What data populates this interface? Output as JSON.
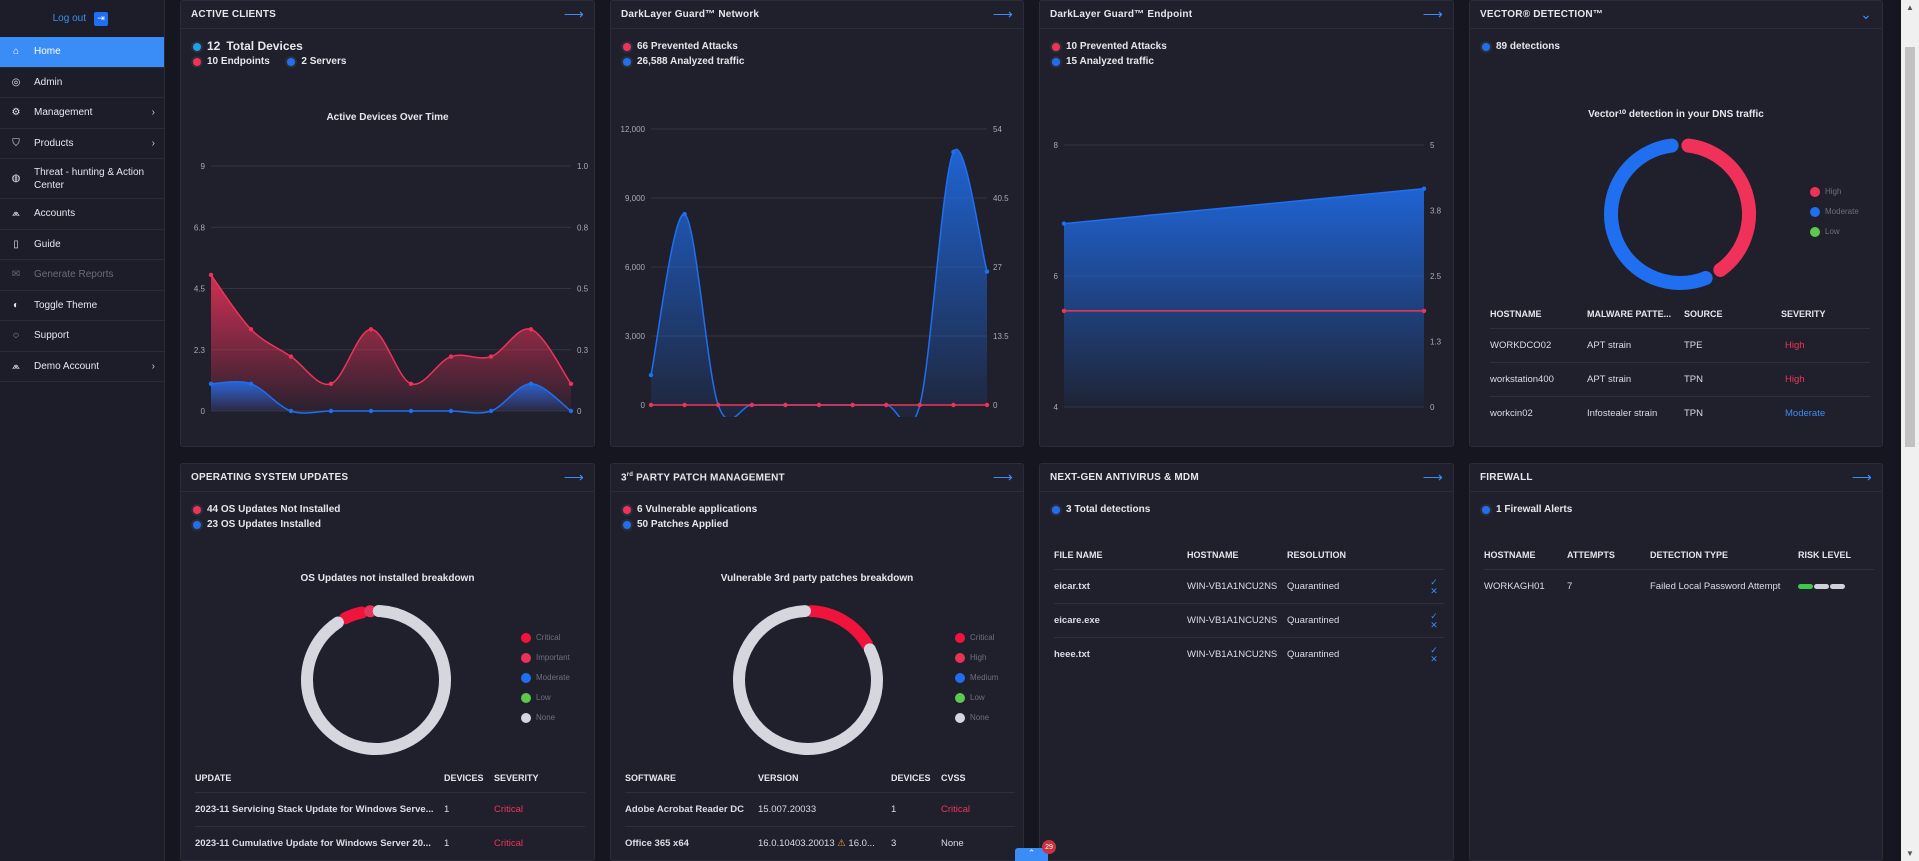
{
  "sidebar": {
    "logout_label": "Log out",
    "items": [
      {
        "label": "Home",
        "icon": "home-icon",
        "active": true
      },
      {
        "label": "Admin",
        "icon": "admin-icon"
      },
      {
        "label": "Management",
        "icon": "management-icon",
        "chevron": true
      },
      {
        "label": "Products",
        "icon": "products-icon",
        "chevron": true
      },
      {
        "label": "Threat - hunting & Action Center",
        "icon": "globe-icon"
      },
      {
        "label": "Accounts",
        "icon": "accounts-icon"
      },
      {
        "label": "Guide",
        "icon": "guide-icon"
      },
      {
        "label": "Generate Reports",
        "icon": "reports-icon",
        "disabled": true
      },
      {
        "label": "Toggle Theme",
        "icon": "theme-icon"
      },
      {
        "label": "Support",
        "icon": "support-icon"
      },
      {
        "label": "Demo Account",
        "icon": "account-icon",
        "chevron": true
      }
    ]
  },
  "colors": {
    "accent": "#3a8cf6",
    "red": "#f0325a",
    "blue": "#1f6ff0",
    "panel": "#1f202c",
    "bg": "#15161f"
  },
  "active_clients": {
    "title": "ACTIVE CLIENTS",
    "total_count": "12",
    "total_label": "Total Devices",
    "endpoints": "10 Endpoints",
    "servers": "2 Servers",
    "chart_title": "Active Devices Over Time"
  },
  "network": {
    "title": "DarkLayer Guard™ Network",
    "attacks": "66 Prevented Attacks",
    "traffic": "26,588 Analyzed traffic"
  },
  "endpoint": {
    "title": "DarkLayer Guard™ Endpoint",
    "attacks": "10 Prevented Attacks",
    "traffic": "15 Analyzed traffic"
  },
  "vector": {
    "title": "VECTOR® DETECTION™",
    "detections": "89 detections",
    "chart_title": "Vector¹⁰ detection in your DNS traffic",
    "legend": [
      "High",
      "Moderate",
      "Low"
    ],
    "columns": [
      "HOSTNAME",
      "MALWARE PATTE...",
      "SOURCE",
      "SEVERITY"
    ],
    "rows": [
      {
        "host": "WORKDCO02",
        "pattern": "APT strain",
        "source": "TPE",
        "severity": "High"
      },
      {
        "host": "workstation400",
        "pattern": "APT strain",
        "source": "TPN",
        "severity": "High"
      },
      {
        "host": "workcin02",
        "pattern": "Infostealer strain",
        "source": "TPN",
        "severity": "Moderate"
      }
    ]
  },
  "os_updates": {
    "title": "OPERATING SYSTEM UPDATES",
    "not_installed": "44 OS Updates Not Installed",
    "installed": "23 OS Updates Installed",
    "chart_title": "OS Updates not installed breakdown",
    "legend": [
      "Critical",
      "Important",
      "Moderate",
      "Low",
      "None"
    ],
    "columns": [
      "UPDATE",
      "DEVICES",
      "SEVERITY"
    ],
    "rows": [
      {
        "update": "2023-11 Servicing Stack Update for Windows Serve...",
        "devices": "1",
        "severity": "Critical"
      },
      {
        "update": "2023-11 Cumulative Update for Windows Server 20...",
        "devices": "1",
        "severity": "Critical"
      }
    ]
  },
  "patch": {
    "title_prefix": "3",
    "title_sup": "rd",
    "title_rest": " PARTY PATCH MANAGEMENT",
    "vulnerable": "6 Vulnerable applications",
    "applied": "50 Patches Applied",
    "chart_title": "Vulnerable 3rd party patches breakdown",
    "legend": [
      "Critical",
      "High",
      "Medium",
      "Low",
      "None"
    ],
    "columns": [
      "SOFTWARE",
      "VERSION",
      "DEVICES",
      "CVSS"
    ],
    "rows": [
      {
        "software": "Adobe Acrobat Reader DC",
        "version": "15.007.20033",
        "version2": "",
        "devices": "1",
        "cvss": "Critical"
      },
      {
        "software": "Office 365 x64",
        "version": "16.0.10403.20013",
        "version2": "16.0...",
        "devices": "3",
        "cvss": "None"
      }
    ]
  },
  "antivirus": {
    "title": "NEXT-GEN ANTIVIRUS & MDM",
    "detections": "3 Total detections",
    "columns": [
      "FILE NAME",
      "HOSTNAME",
      "RESOLUTION"
    ],
    "rows": [
      {
        "file": "eicar.txt",
        "host": "WIN-VB1A1NCU2NS",
        "resolution": "Quarantined"
      },
      {
        "file": "eicare.exe",
        "host": "WIN-VB1A1NCU2NS",
        "resolution": "Quarantined"
      },
      {
        "file": "heee.txt",
        "host": "WIN-VB1A1NCU2NS",
        "resolution": "Quarantined"
      }
    ]
  },
  "firewall": {
    "title": "FIREWALL",
    "alerts": "1 Firewall Alerts",
    "columns": [
      "HOSTNAME",
      "ATTEMPTS",
      "DETECTION TYPE",
      "RISK LEVEL"
    ],
    "rows": [
      {
        "host": "WORKAGH01",
        "attempts": "7",
        "type": "Failed Local Password Attempt",
        "risk_level": 1
      }
    ]
  },
  "notification_count": "29",
  "chart_data": [
    {
      "type": "area",
      "title": "Active Devices Over Time",
      "x": [
        0,
        1,
        2,
        3,
        4,
        5,
        6,
        7,
        8,
        9
      ],
      "ylim": [
        0,
        9
      ],
      "y2lim": [
        0,
        1.0
      ],
      "yticks": [
        "0",
        "2.3",
        "4.5",
        "6.8",
        "9"
      ],
      "y2ticks": [
        "0",
        "0.3",
        "0.5",
        "0.8",
        "1.0"
      ],
      "series": [
        {
          "name": "Endpoints",
          "color": "#f0325a",
          "values": [
            5,
            3,
            2,
            1,
            3,
            1,
            2,
            2,
            3,
            1
          ]
        },
        {
          "name": "Servers",
          "color": "#1f6ff0",
          "values": [
            1,
            1,
            0,
            0,
            0,
            0,
            0,
            0,
            1,
            0
          ]
        }
      ]
    },
    {
      "type": "area",
      "title": "",
      "x": [
        0,
        1,
        2,
        3,
        4,
        5,
        6,
        7,
        8,
        9,
        10
      ],
      "ylim": [
        0,
        12000
      ],
      "y2lim": [
        0,
        54
      ],
      "yticks": [
        "0",
        "3,000",
        "6,000",
        "9,000",
        "12,000"
      ],
      "y2ticks": [
        "0",
        "13.5",
        "27",
        "40.5",
        "54"
      ],
      "series": [
        {
          "name": "Analyzed traffic",
          "color": "#1f6ff0",
          "values": [
            1300,
            8300,
            0,
            0,
            0,
            0,
            0,
            0,
            0,
            11000,
            5800
          ]
        },
        {
          "name": "Prevented Attacks",
          "color": "#f0325a",
          "values": [
            0,
            0,
            0,
            0,
            0,
            0,
            0,
            0,
            0.1,
            0.2,
            0
          ]
        }
      ]
    },
    {
      "type": "area",
      "title": "",
      "x": [
        0,
        1
      ],
      "ylim": [
        3,
        9
      ],
      "y2lim": [
        0,
        5
      ],
      "yticks": [
        "4",
        "6",
        "8"
      ],
      "y2ticks": [
        "0",
        "1.3",
        "2.5",
        "3.8",
        "5"
      ],
      "series": [
        {
          "name": "Analyzed traffic",
          "color": "#1f6ff0",
          "values": [
            7.2,
            8
          ]
        },
        {
          "name": "Prevented Attacks",
          "color": "#f0325a",
          "values": [
            5.2,
            5.2
          ]
        }
      ]
    },
    {
      "type": "pie",
      "title": "Vector¹⁰ detection in your DNS traffic",
      "categories": [
        "High",
        "Moderate",
        "Low"
      ],
      "values": [
        42,
        58,
        0
      ],
      "colors": [
        "#f0325a",
        "#1f6ff0",
        "#5ec84a"
      ]
    },
    {
      "type": "pie",
      "title": "OS Updates not installed breakdown",
      "categories": [
        "Critical",
        "Important",
        "Moderate",
        "Low",
        "None"
      ],
      "values": [
        6,
        2,
        0,
        0,
        92
      ],
      "colors": [
        "#f0143c",
        "#e8325a",
        "#1f6ff0",
        "#5ec84a",
        "#d6d6de"
      ]
    },
    {
      "type": "pie",
      "title": "Vulnerable 3rd party patches breakdown",
      "categories": [
        "Critical",
        "High",
        "Medium",
        "Low",
        "None"
      ],
      "values": [
        17,
        0,
        0,
        0,
        83
      ],
      "colors": [
        "#f0143c",
        "#e8325a",
        "#1f6ff0",
        "#5ec84a",
        "#d6d6de"
      ]
    }
  ]
}
